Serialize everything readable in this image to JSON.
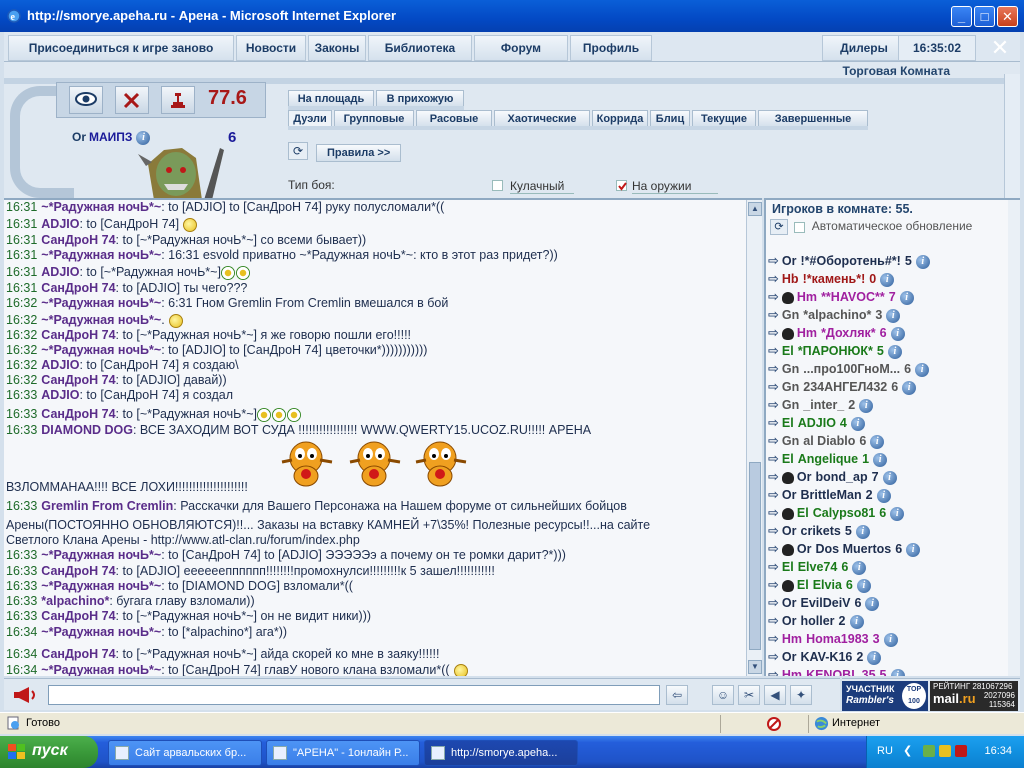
{
  "window": {
    "title": "http://smorye.apeha.ru - Арена - Microsoft Internet Explorer",
    "minimize": "_",
    "maximize": "□",
    "close": "✕"
  },
  "nav": {
    "rejoin": "Присоединиться к игре заново",
    "news": "Новости",
    "laws": "Законы",
    "library": "Библиотека",
    "forum": "Форум",
    "profile": "Профиль",
    "dealers": "Дилеры",
    "time": "16:35:02"
  },
  "room": {
    "label": "Торговая Комната"
  },
  "profile": {
    "level": "77.6",
    "clan": "Or",
    "name": "МАИПЗ",
    "count": "6"
  },
  "tabs": {
    "row1": [
      "На площадь",
      "В прихожую"
    ],
    "row2": [
      "Дуэли",
      "Групповые",
      "Расовые",
      "Хаотические",
      "Коррида",
      "Блиц",
      "Текущие",
      "Завершенные"
    ],
    "rules": "Правила >>",
    "fight_type_label": "Тип боя:",
    "fist": "Кулачный",
    "weapon": "На оружии"
  },
  "chat": [
    {
      "t": "16:31",
      "n": "~*Радужная ночЬ*~",
      "m": ": to [ADJIO] to [СанДроН 74] руку полусломали*(("
    },
    {
      "t": "16:31",
      "n": "ADJIO",
      "m": ": to [СанДроН 74]"
    },
    {
      "t": "16:31",
      "n": "СанДроН 74",
      "m": ": to [~*Радужная ночЬ*~] со всеми бывает))"
    },
    {
      "t": "16:31",
      "n": "~*Радужная ночЬ*~",
      "m": ": 16:31 esvold приватно ~*Радужная ночЬ*~: кто в этот раз придет?))"
    },
    {
      "t": "16:31",
      "n": "ADJIO",
      "m": ": to [~*Радужная ночЬ*~]"
    },
    {
      "t": "16:31",
      "n": "СанДроН 74",
      "m": ": to [ADJIO] ты чего???"
    },
    {
      "t": "16:32",
      "n": "~*Радужная ночЬ*~",
      "m": ": 6:31 Гном Gremlin From Cremlin вмешался в бой"
    },
    {
      "t": "16:32",
      "n": "~*Радужная ночЬ*~",
      "m": "."
    },
    {
      "t": "16:32",
      "n": "СанДроН 74",
      "m": ": to [~*Радужная ночЬ*~] я же говорю пошли его!!!!!"
    },
    {
      "t": "16:32",
      "n": "~*Радужная ночЬ*~",
      "m": ": to [ADJIO] to [СанДроН 74] цветочки*)))))))))))"
    },
    {
      "t": "16:32",
      "n": "ADJIO",
      "m": ": to [СанДроН 74] я создаю\\"
    },
    {
      "t": "16:32",
      "n": "СанДроН 74",
      "m": ": to [ADJIO] давай))"
    },
    {
      "t": "16:33",
      "n": "ADJIO",
      "m": ": to [СанДроН 74] я создал"
    },
    {
      "t": "16:33",
      "n": "СанДроН 74",
      "m": ": to [~*Радужная ночЬ*~]"
    },
    {
      "t": "16:33",
      "n": "DIAMOND DOG",
      "m": ": ВСЕ ЗАХОДИМ ВОТ СУДА !!!!!!!!!!!!!!!!! WWW.QWERTY15.UCOZ.RU!!!!! АРЕНА"
    },
    {
      "t": "",
      "n": "",
      "m": "ВЗЛОММАНАА!!!! ВСЕ ЛОХИ!!!!!!!!!!!!!!!!!!!!!"
    },
    {
      "t": "16:33",
      "n": "Gremlin From Cremlin",
      "m": ":      Расскачки для Вашего Персонажа на Нашем форуме от сильнейших бойцов"
    },
    {
      "t": "",
      "n": "",
      "m": "Арены(ПОСТОЯННО ОБНОВЛЯЮТСЯ)!!...   Заказы на вставку КАМНЕЙ +7\\35%! Полезные ресурсы!!...на сайте"
    },
    {
      "t": "",
      "n": "",
      "m": "Светлого Клана Арены - http://www.atl-clan.ru/forum/index.php"
    },
    {
      "t": "16:33",
      "n": "~*Радужная ночЬ*~",
      "m": ": to [СанДроН 74] to [ADJIO] ЭЭЭЭЭэ а почему он те ромки дарит?*)))"
    },
    {
      "t": "16:33",
      "n": "СанДроН 74",
      "m": ": to [ADJIO] еееееепппппп!!!!!!!!промохнулси!!!!!!!!!к 5 зашел!!!!!!!!!!!"
    },
    {
      "t": "16:33",
      "n": "~*Радужная ночЬ*~",
      "m": ": to [DIAMOND DOG] взломали*(("
    },
    {
      "t": "16:33",
      "n": "*alpachino*",
      "m": ": бугага главу взломали))"
    },
    {
      "t": "16:33",
      "n": "СанДроН 74",
      "m": ": to [~*Радужная ночЬ*~] он не видит ники)))"
    },
    {
      "t": "16:34",
      "n": "~*Радужная ночЬ*~",
      "m": ": to [*alpachino*] ага*))"
    },
    {
      "t": "16:34",
      "n": "СанДроН 74",
      "m": ": to [~*Радужная ночЬ*~] айда скорей ко мне в заяку!!!!!!"
    },
    {
      "t": "16:34",
      "n": "~*Радужная ночЬ*~",
      "m": ": to [СанДроН 74]     главУ нового клана взломали*(("
    }
  ],
  "players": {
    "title": "Игроков в комнате: 55.",
    "auto_refresh": "Автоматическое обновление",
    "list": [
      {
        "c": "Or",
        "n": "!*#Оборотень#*!",
        "l": "5",
        "color": "#1e2e4e"
      },
      {
        "c": "Hb",
        "n": "!*камень*!",
        "l": "0",
        "color": "#a01818"
      },
      {
        "c": "Hm",
        "n": "**HAVOC**",
        "l": "7",
        "color": "#a020a0"
      },
      {
        "c": "Gn",
        "n": "*alpachino*",
        "l": "3",
        "color": "#555555"
      },
      {
        "c": "Hm",
        "n": "*Дохляк*",
        "l": "6",
        "color": "#a020a0"
      },
      {
        "c": "El",
        "n": "*ПАРОНЮК*",
        "l": "5",
        "color": "#1a7a1a"
      },
      {
        "c": "Gn",
        "n": "...про100ГноМ...",
        "l": "6",
        "color": "#555555"
      },
      {
        "c": "Gn",
        "n": "234АНГЕЛ432",
        "l": "6",
        "color": "#555555"
      },
      {
        "c": "Gn",
        "n": "_inter_",
        "l": "2",
        "color": "#555555"
      },
      {
        "c": "El",
        "n": "ADJIO",
        "l": "4",
        "color": "#1a7a1a"
      },
      {
        "c": "Gn",
        "n": "al Diablo",
        "l": "6",
        "color": "#555555"
      },
      {
        "c": "El",
        "n": "Angelique",
        "l": "1",
        "color": "#1a7a1a"
      },
      {
        "c": "Or",
        "n": "bond_ap",
        "l": "7",
        "color": "#1e2e4e"
      },
      {
        "c": "Or",
        "n": "BrittleMan",
        "l": "2",
        "color": "#1e2e4e"
      },
      {
        "c": "El",
        "n": "Calypso81",
        "l": "6",
        "color": "#1a7a1a"
      },
      {
        "c": "Or",
        "n": "crikets",
        "l": "5",
        "color": "#1e2e4e"
      },
      {
        "c": "Or",
        "n": "Dos Muertos",
        "l": "6",
        "color": "#1e2e4e"
      },
      {
        "c": "El",
        "n": "Elve74",
        "l": "6",
        "color": "#1a7a1a"
      },
      {
        "c": "El",
        "n": "Elvia",
        "l": "6",
        "color": "#1a7a1a"
      },
      {
        "c": "Or",
        "n": "EvilDeiV",
        "l": "6",
        "color": "#1e2e4e"
      },
      {
        "c": "Or",
        "n": "holler",
        "l": "2",
        "color": "#1e2e4e"
      },
      {
        "c": "Hm",
        "n": "Homa1983",
        "l": "3",
        "color": "#a020a0"
      },
      {
        "c": "Or",
        "n": "KAV-K16",
        "l": "2",
        "color": "#1e2e4e"
      },
      {
        "c": "Hm",
        "n": "KENOBI_35",
        "l": "5",
        "color": "#a020a0"
      }
    ]
  },
  "banners": {
    "top100_1": "УЧАСТНИК",
    "top100_2": "Rambler's",
    "top100_3": "TOP 100",
    "mail_rating": "РЕЙТИНГ 281067296",
    "mail_n1": "2027096",
    "mail_n2": "115364",
    "mail_brand": "mail",
    "mail_ru": ".ru"
  },
  "status": {
    "ready": "Готово",
    "zone": "Интернет"
  },
  "taskbar": {
    "start": "пуск",
    "task1": "Сайт арвальских бр...",
    "task2": "\"АРЕНА\" - 1онлайн Р...",
    "task3": "http://smorye.apeha...",
    "lang": "RU",
    "clock": "16:34"
  }
}
